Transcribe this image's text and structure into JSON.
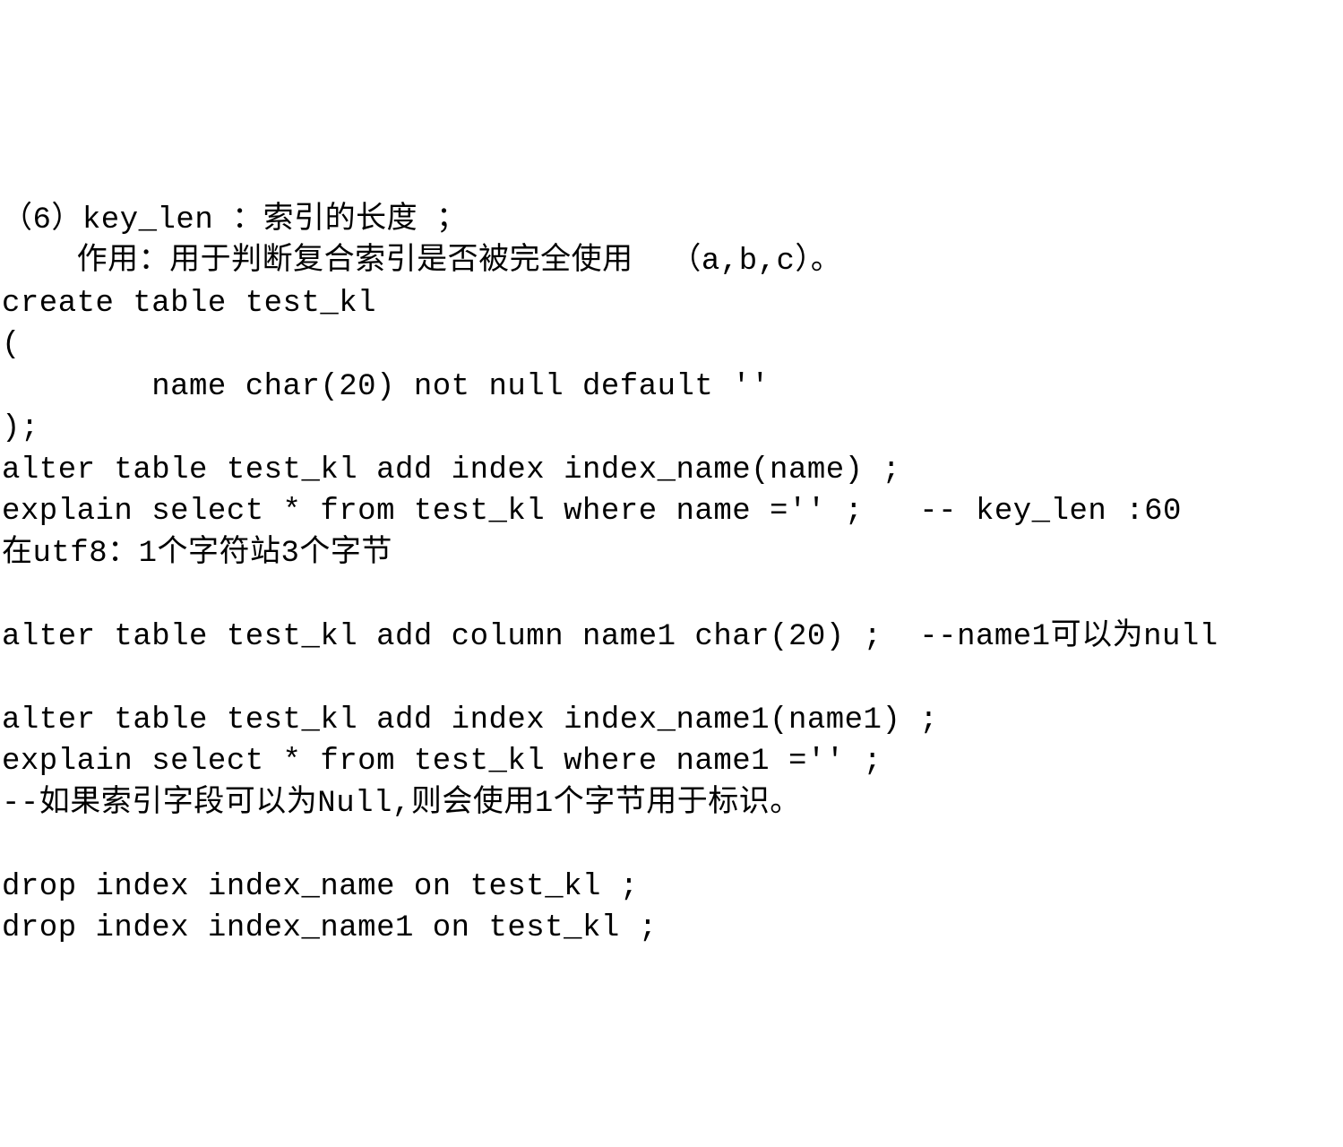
{
  "lines": {
    "l1": "（6）key_len ：索引的长度 ；",
    "l2": "    作用：用于判断复合索引是否被完全使用  （a,b,c）。",
    "l3": "create table test_kl",
    "l4": "(",
    "l5": "        name char(20) not null default ''",
    "l6": ");",
    "l7": "alter table test_kl add index index_name(name) ;",
    "l8": "explain select * from test_kl where name ='' ;   -- key_len :60",
    "l9": "在utf8：1个字符站3个字节",
    "l10": "",
    "l11": "alter table test_kl add column name1 char(20) ;  --name1可以为null",
    "l12": "",
    "l13": "alter table test_kl add index index_name1(name1) ;",
    "l14": "explain select * from test_kl where name1 ='' ;",
    "l15": "--如果索引字段可以为Null,则会使用1个字节用于标识。",
    "l16": "",
    "l17": "drop index index_name on test_kl ;",
    "l18": "drop index index_name1 on test_kl ;"
  }
}
